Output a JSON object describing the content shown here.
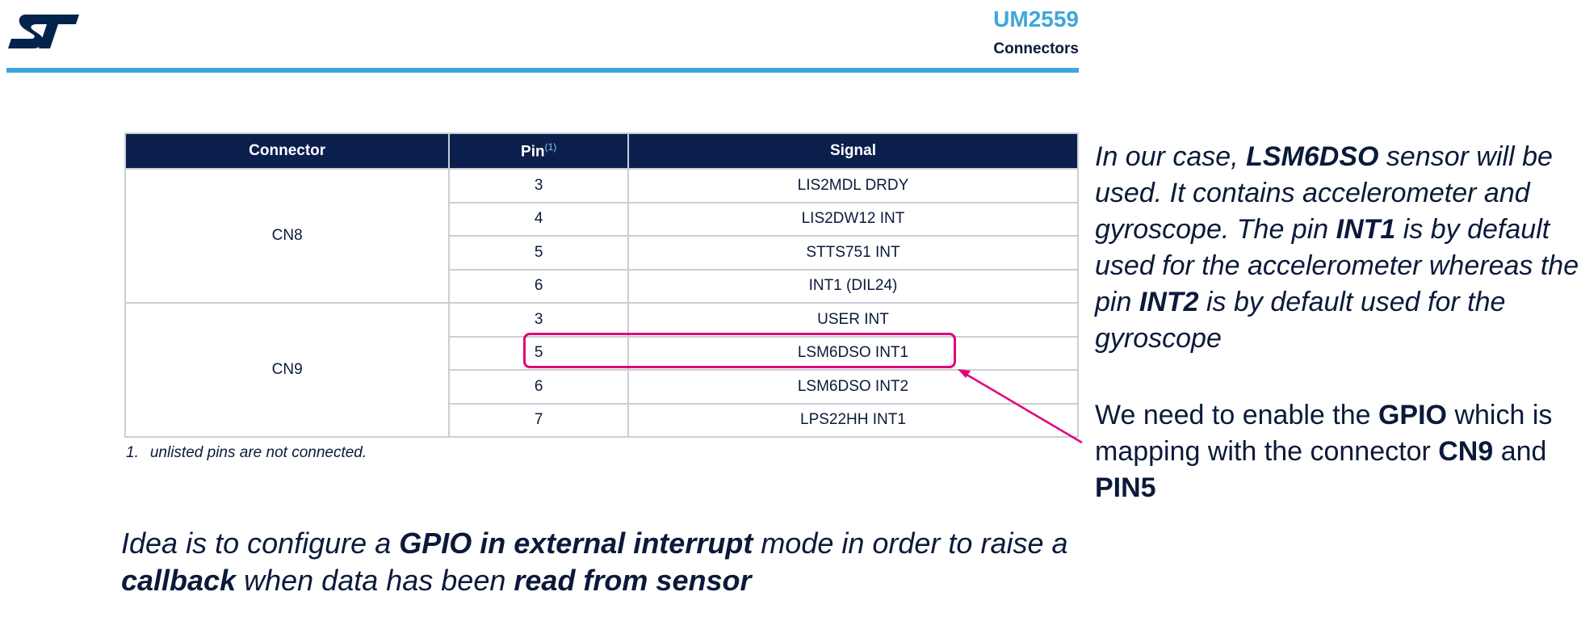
{
  "header": {
    "logo_text": "ST",
    "doc_id": "UM2559",
    "section": "Connectors"
  },
  "table": {
    "headers": [
      "Connector",
      "Pin",
      "Signal"
    ],
    "pin_footnote_mark": "(1)",
    "groups": [
      {
        "connector": "CN8",
        "rows": [
          {
            "pin": "3",
            "signal": "LIS2MDL DRDY"
          },
          {
            "pin": "4",
            "signal": "LIS2DW12 INT"
          },
          {
            "pin": "5",
            "signal": "STTS751 INT"
          },
          {
            "pin": "6",
            "signal": "INT1 (DIL24)"
          }
        ]
      },
      {
        "connector": "CN9",
        "rows": [
          {
            "pin": "3",
            "signal": "USER INT"
          },
          {
            "pin": "5",
            "signal": "LSM6DSO INT1"
          },
          {
            "pin": "6",
            "signal": "LSM6DSO INT2"
          },
          {
            "pin": "7",
            "signal": "LPS22HH INT1"
          }
        ]
      }
    ],
    "footnote_num": "1.",
    "footnote_text": "unlisted pins are not connected."
  },
  "note": {
    "s1": "In our case, ",
    "s2": "LSM6DSO",
    "s3": " sensor will be used. It contains accelerometer and gyroscope. The pin ",
    "s4": "INT1",
    "s5": " is by default used for the accelerometer whereas the pin ",
    "s6": "INT2",
    "s7": " is by default used for the gyroscope"
  },
  "note2": {
    "s1": "We need to enable the ",
    "s2": "GPIO",
    "s3": " which is mapping with the connector ",
    "s4": "CN9",
    "s5": " and ",
    "s6": "PIN5"
  },
  "idea": {
    "s1": "Idea is to configure a ",
    "s2": "GPIO in external interrupt",
    "s3": " mode in order to raise a ",
    "s4": "callback",
    "s5": " when data has been ",
    "s6": "read from sensor"
  },
  "colors": {
    "brand_blue": "#3ca7db",
    "header_navy": "#0b1f4d",
    "highlight_magenta": "#e2007a",
    "text_navy": "#0b1a3a"
  }
}
